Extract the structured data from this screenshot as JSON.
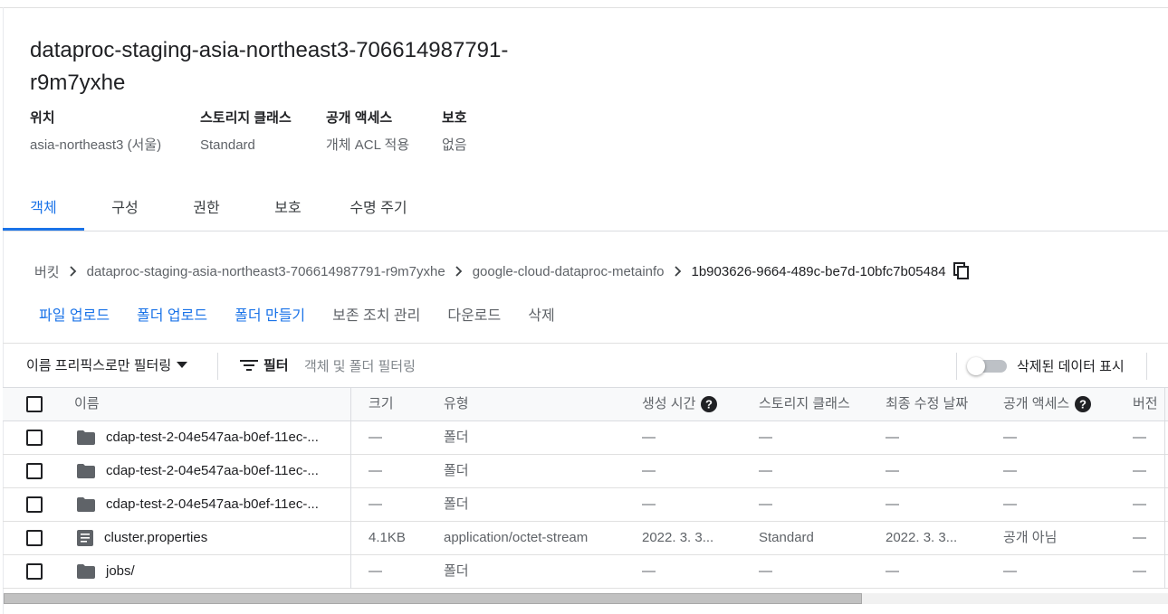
{
  "bucket": {
    "title": "dataproc-staging-asia-northeast3-706614987791-r9m7yxhe",
    "meta": [
      {
        "label": "위치",
        "value": "asia-northeast3 (서울)"
      },
      {
        "label": "스토리지 클래스",
        "value": "Standard"
      },
      {
        "label": "공개 액세스",
        "value": "개체 ACL 적용"
      },
      {
        "label": "보호",
        "value": "없음"
      }
    ]
  },
  "tabs": [
    {
      "label": "객체",
      "active": true
    },
    {
      "label": "구성",
      "active": false
    },
    {
      "label": "권한",
      "active": false
    },
    {
      "label": "보호",
      "active": false
    },
    {
      "label": "수명 주기",
      "active": false
    }
  ],
  "breadcrumb": {
    "items": [
      "버킷",
      "dataproc-staging-asia-northeast3-706614987791-r9m7yxhe",
      "google-cloud-dataproc-metainfo",
      "1b903626-9664-489c-be7d-10bfc7b05484"
    ]
  },
  "actions": {
    "upload_file": "파일 업로드",
    "upload_folder": "폴더 업로드",
    "create_folder": "폴더 만들기",
    "manage_holds": "보존 조치 관리",
    "download": "다운로드",
    "delete": "삭제"
  },
  "filter": {
    "prefix_label": "이름 프리픽스로만 필터링",
    "filter_label": "필터",
    "placeholder": "객체 및 폴더 필터링",
    "show_deleted_label": "삭제된 데이터 표시",
    "show_deleted": false
  },
  "table": {
    "columns": {
      "name": "이름",
      "size": "크기",
      "type": "유형",
      "created": "생성 시간",
      "storage_class": "스토리지 클래스",
      "modified": "최종 수정 날짜",
      "public_access": "공개 액세스",
      "version": "버전"
    },
    "rows": [
      {
        "icon": "folder-icon",
        "name": "cdap-test-2-04e547aa-b0ef-11ec-...",
        "size": "—",
        "type": "폴더",
        "created": "—",
        "storage_class": "—",
        "modified": "—",
        "public_access": "—",
        "version": "—"
      },
      {
        "icon": "folder-icon",
        "name": "cdap-test-2-04e547aa-b0ef-11ec-...",
        "size": "—",
        "type": "폴더",
        "created": "—",
        "storage_class": "—",
        "modified": "—",
        "public_access": "—",
        "version": "—"
      },
      {
        "icon": "folder-icon",
        "name": "cdap-test-2-04e547aa-b0ef-11ec-...",
        "size": "—",
        "type": "폴더",
        "created": "—",
        "storage_class": "—",
        "modified": "—",
        "public_access": "—",
        "version": "—"
      },
      {
        "icon": "file-icon",
        "name": "cluster.properties",
        "size": "4.1KB",
        "type": "application/octet-stream",
        "created": "2022. 3. 3...",
        "storage_class": "Standard",
        "modified": "2022. 3. 3...",
        "public_access": "공개 아님",
        "version": "—"
      },
      {
        "icon": "folder-icon",
        "name": "jobs/",
        "size": "—",
        "type": "폴더",
        "created": "—",
        "storage_class": "—",
        "modified": "—",
        "public_access": "—",
        "version": "—"
      }
    ]
  },
  "colors": {
    "accent": "#1a73e8",
    "text": "#202124",
    "muted": "#5f6368",
    "border": "#dadce0"
  }
}
